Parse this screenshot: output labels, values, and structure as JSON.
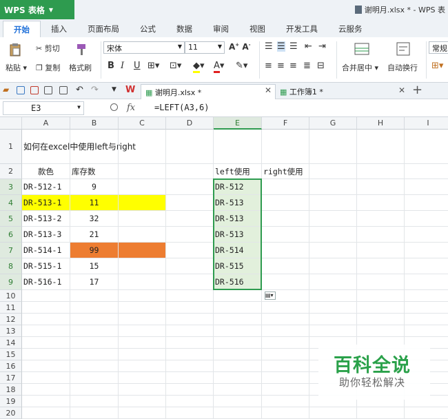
{
  "app": {
    "name": "WPS 表格",
    "window_title": "谢明月.xlsx * - WPS 表"
  },
  "ribbon_tabs": [
    "开始",
    "插入",
    "页面布局",
    "公式",
    "数据",
    "审阅",
    "视图",
    "开发工具",
    "云服务"
  ],
  "ribbon": {
    "cut": "剪切",
    "paste": "粘贴",
    "copy": "复制",
    "format_painter": "格式刷",
    "font_name": "宋体",
    "font_size": "11",
    "bold": "B",
    "italic": "I",
    "underline": "U",
    "merge_center": "合并居中",
    "wrap_text": "自动换行",
    "number_format": "常规"
  },
  "doc_tabs": [
    {
      "label": "谢明月.xlsx *"
    },
    {
      "label": "工作簿1 *"
    }
  ],
  "formula_bar": {
    "cell_ref": "E3",
    "fx": "fx",
    "formula": "=LEFT(A3,6)"
  },
  "columns": [
    "A",
    "B",
    "C",
    "D",
    "E",
    "F",
    "G",
    "H",
    "I"
  ],
  "rows": [
    "1",
    "2",
    "3",
    "4",
    "5",
    "6",
    "7",
    "8",
    "9",
    "10",
    "11",
    "12",
    "13",
    "14",
    "15",
    "16",
    "17",
    "18",
    "19",
    "20"
  ],
  "sheet": {
    "title": "如何在excel中使用left与right",
    "header_a": "款色",
    "header_b": "库存数",
    "header_e": "left使用",
    "header_f": "right使用",
    "codes": [
      "DR-512-1",
      "DR-513-1",
      "DR-513-2",
      "DR-513-3",
      "DR-514-1",
      "DR-515-1",
      "DR-516-1"
    ],
    "stock": [
      "9",
      "11",
      "32",
      "21",
      "99",
      "15",
      "17"
    ],
    "left_results": [
      "DR-512",
      "DR-513",
      "DR-513",
      "DR-513",
      "DR-514",
      "DR-515",
      "DR-516"
    ]
  },
  "colors": {
    "yellow_highlight": "#ffff00",
    "orange_highlight": "#ed7d31",
    "selection_green": "#2e9b4f",
    "wps_green": "#2e9b4f"
  },
  "watermark": {
    "main": "百科全说",
    "sub": "助你轻松解决"
  }
}
